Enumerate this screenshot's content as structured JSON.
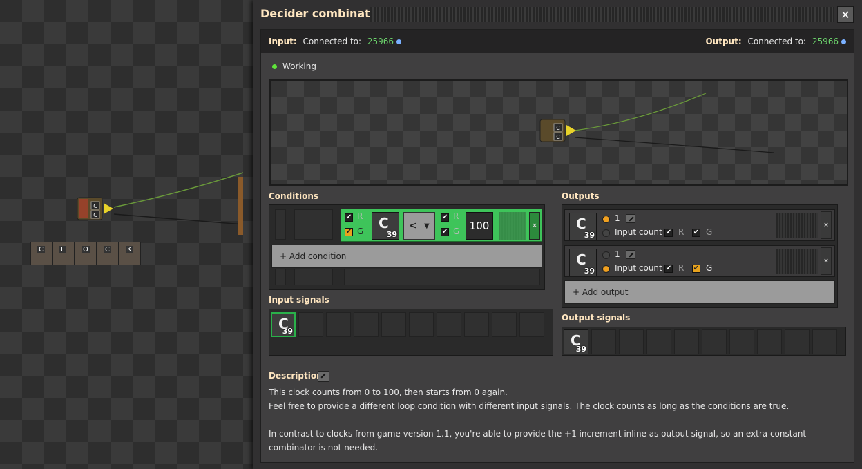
{
  "window": {
    "title": "Decider combinator",
    "close_label": "✕"
  },
  "connections": {
    "input_label": "Input:",
    "input_connected": "Connected to:",
    "input_id": "25966",
    "output_label": "Output:",
    "output_connected": "Connected to:",
    "output_id": "25966"
  },
  "status": {
    "text": "Working",
    "color": "#5fe33a"
  },
  "world": {
    "clock_letters": [
      "C",
      "L",
      "O",
      "C",
      "K"
    ],
    "combinator_signal": "C"
  },
  "conditions": {
    "title": "Conditions",
    "row": {
      "r_label": "R",
      "g_label": "G",
      "r_checked": true,
      "g_checked": true,
      "signal": "C",
      "signal_count": "39",
      "comparator": "<",
      "constant": "100",
      "remove": "×"
    },
    "add_label": "+ Add condition"
  },
  "outputs": {
    "title": "Outputs",
    "rows": [
      {
        "signal": "C",
        "count": "39",
        "value": "1",
        "value_selected": true,
        "input_count_label": "Input count",
        "input_count_selected": false,
        "r_label": "R",
        "g_label": "G",
        "remove": "×"
      },
      {
        "signal": "C",
        "count": "39",
        "value": "1",
        "value_selected": false,
        "input_count_label": "Input count",
        "input_count_selected": true,
        "r_label": "R",
        "g_label": "G",
        "remove": "×"
      }
    ],
    "add_label": "+ Add output"
  },
  "input_signals": {
    "title": "Input signals",
    "signal": "C",
    "count": "39"
  },
  "output_signals": {
    "title": "Output signals",
    "signal": "C",
    "count": "39"
  },
  "description": {
    "title": "Description",
    "line1": "This clock counts from 0 to 100, then starts from 0 again.",
    "line2": "Feel free to provide a different loop condition with different input signals. The clock counts as long as the conditions are true.",
    "line3": "In contrast to clocks from game version 1.1, you're able to provide the +1 increment inline as output signal, so an extra constant combinator is not needed."
  },
  "colors": {
    "accent_green": "#6cd46c",
    "condition_active": "#3ec45a",
    "title": "#ffe6c0",
    "checkbox_orange": "#e8a31e"
  }
}
